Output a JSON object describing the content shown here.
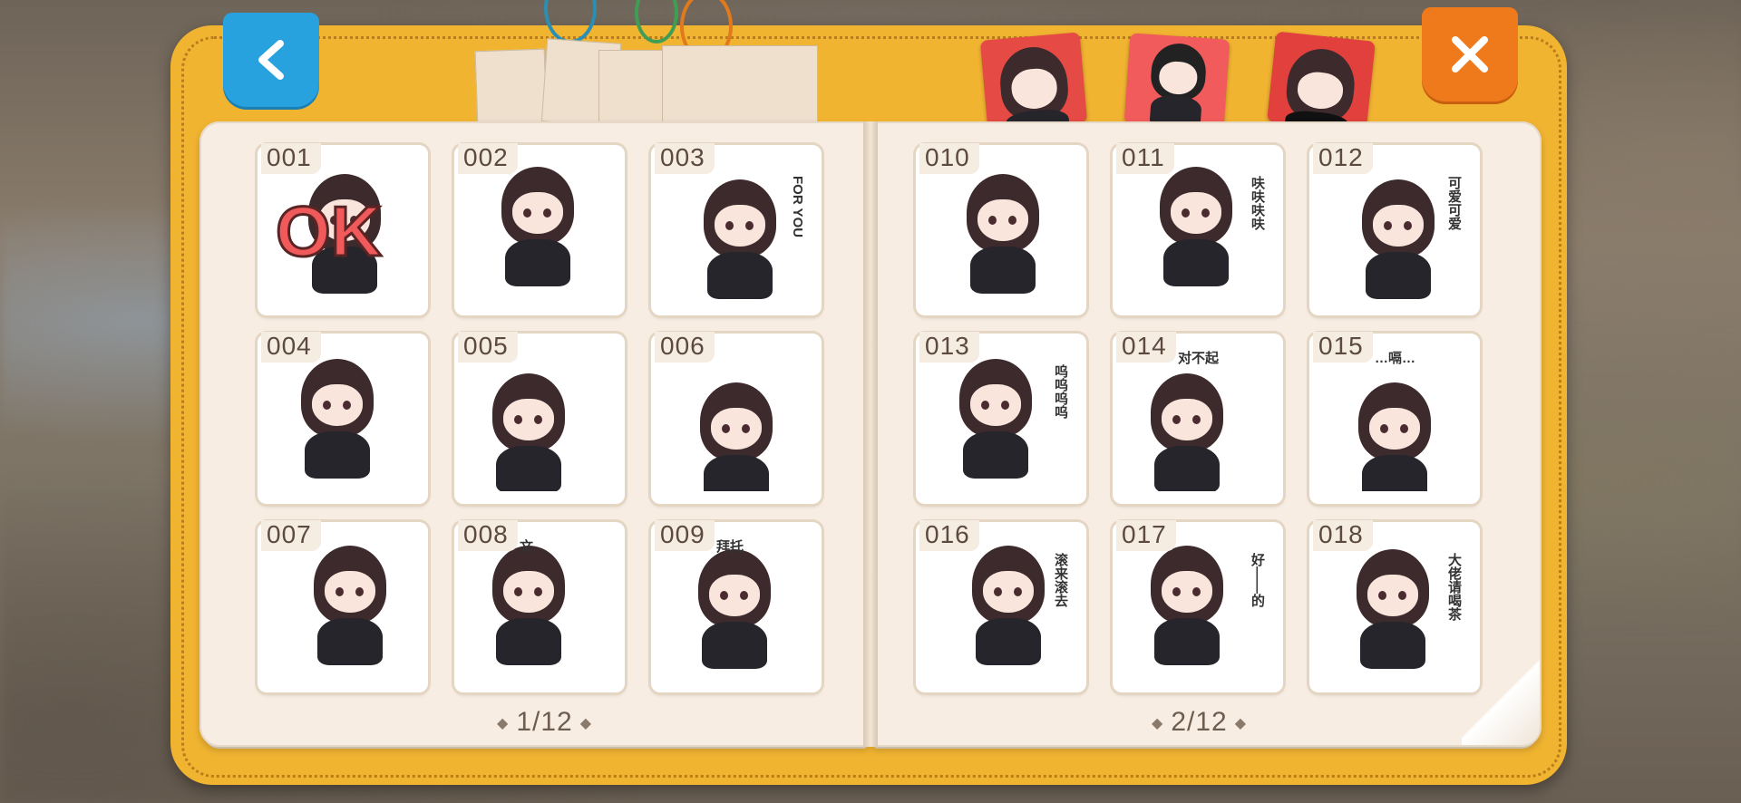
{
  "header": {
    "back_icon": "chevron-left-icon",
    "close_icon": "close-icon",
    "colors": {
      "back": "#27a2de",
      "close": "#ef7a1c",
      "cover": "#f3b733",
      "page": "#f7ede2"
    }
  },
  "category_tabs": [
    {
      "name": "sticker-pack-1",
      "color": "#e64a44"
    },
    {
      "name": "sticker-pack-2",
      "color": "#f25b5b"
    },
    {
      "name": "sticker-pack-3",
      "color": "#e2403d"
    }
  ],
  "left_page": {
    "stickers": [
      {
        "num": "001",
        "text": "OK"
      },
      {
        "num": "002",
        "text": ""
      },
      {
        "num": "003",
        "text": "FOR YOU"
      },
      {
        "num": "004",
        "text": ""
      },
      {
        "num": "005",
        "text": ""
      },
      {
        "num": "006",
        "text": ""
      },
      {
        "num": "007",
        "text": ""
      },
      {
        "num": "008",
        "text": "文"
      },
      {
        "num": "009",
        "text": "拜托"
      }
    ],
    "pager": "1/12"
  },
  "right_page": {
    "stickers": [
      {
        "num": "010",
        "text": ""
      },
      {
        "num": "011",
        "text": "呋呋呋呋"
      },
      {
        "num": "012",
        "text": "可爱可爱"
      },
      {
        "num": "013",
        "text": "呜呜呜呜"
      },
      {
        "num": "014",
        "text": "对不起"
      },
      {
        "num": "015",
        "text": "…嗝…"
      },
      {
        "num": "016",
        "text": "滚来滚去"
      },
      {
        "num": "017",
        "text": "好——的"
      },
      {
        "num": "018",
        "text": "大佬请喝茶"
      }
    ],
    "pager": "2/12"
  }
}
